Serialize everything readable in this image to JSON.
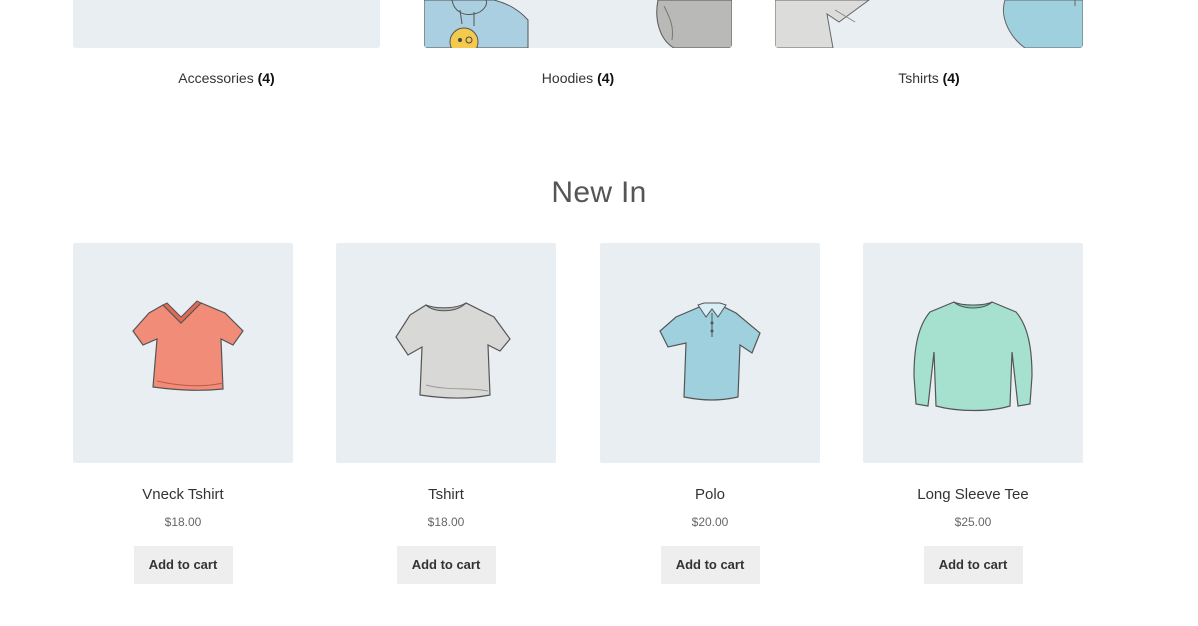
{
  "categories": [
    {
      "name": "Accessories",
      "count": "(4)"
    },
    {
      "name": "Hoodies",
      "count": "(4)"
    },
    {
      "name": "Tshirts",
      "count": "(4)"
    }
  ],
  "section_title": "New In",
  "products": [
    {
      "name": "Vneck Tshirt",
      "price": "$18.00",
      "button": "Add to cart",
      "icon": "vneck-tshirt-icon",
      "color": "#f08c78"
    },
    {
      "name": "Tshirt",
      "price": "$18.00",
      "button": "Add to cart",
      "icon": "tshirt-icon",
      "color": "#d8d8d6"
    },
    {
      "name": "Polo",
      "price": "$20.00",
      "button": "Add to cart",
      "icon": "polo-icon",
      "color": "#9fd0de"
    },
    {
      "name": "Long Sleeve Tee",
      "price": "$25.00",
      "button": "Add to cart",
      "icon": "long-sleeve-tee-icon",
      "color": "#a6e0cf"
    }
  ]
}
